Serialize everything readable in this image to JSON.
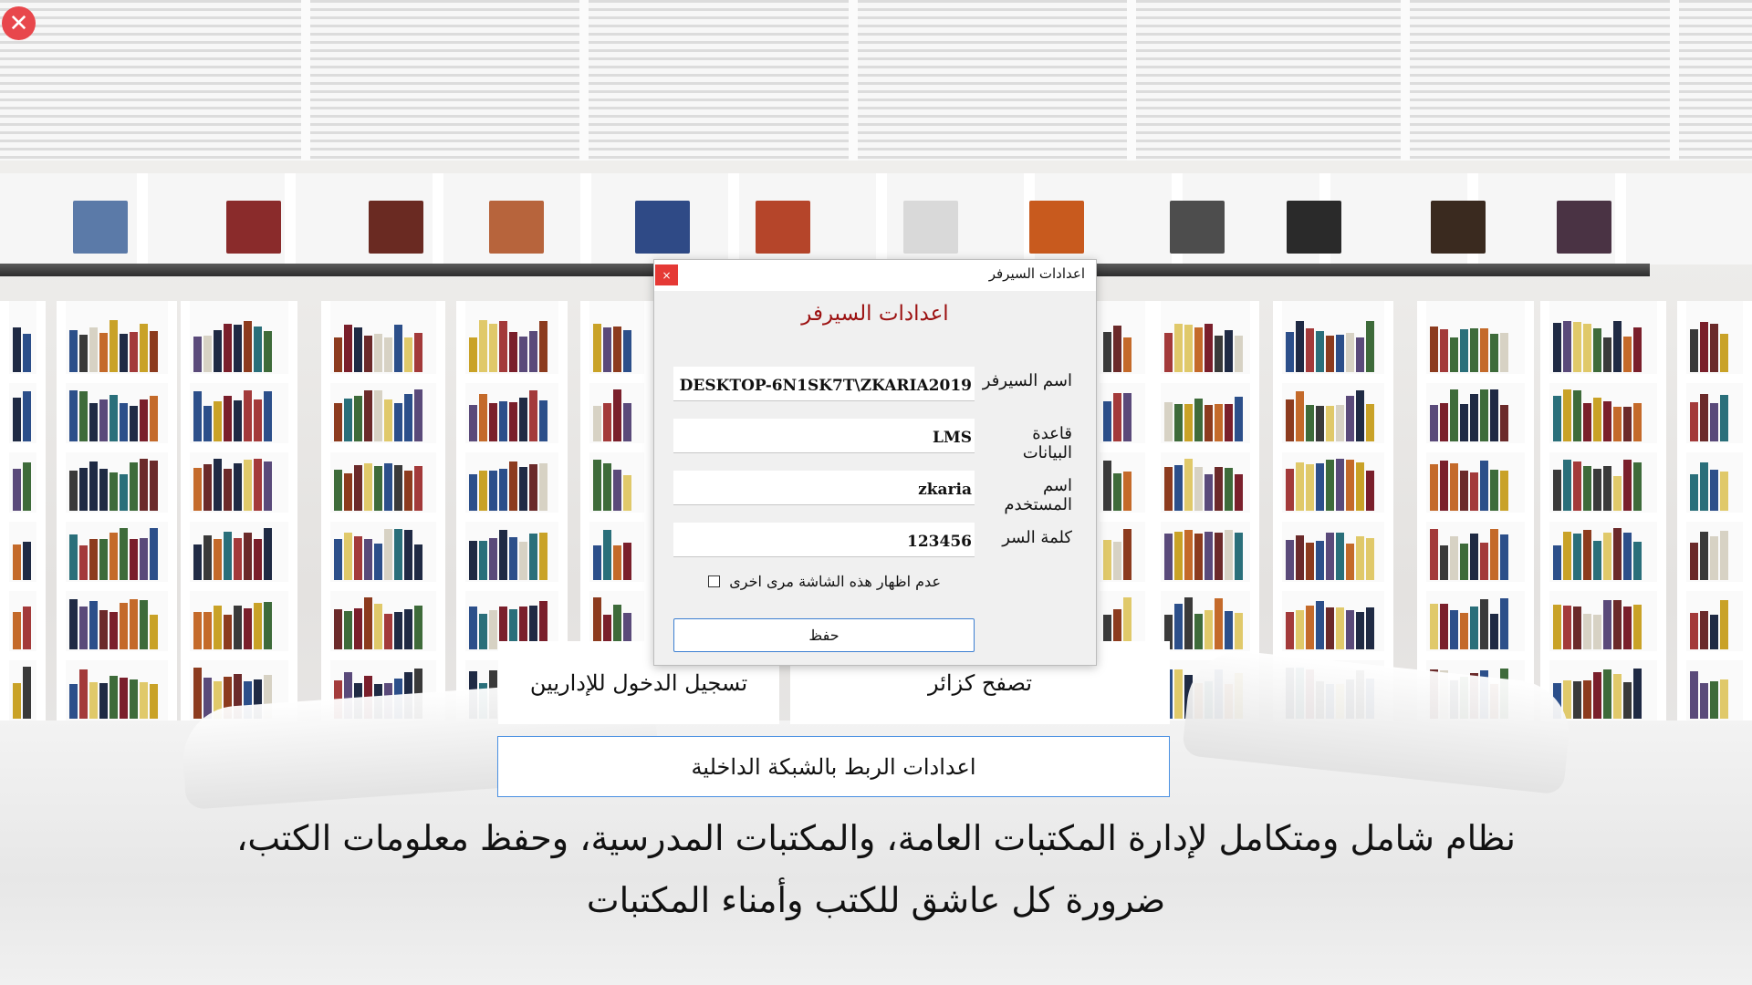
{
  "app": {
    "close_glyph": "✕",
    "buttons": {
      "browse": "تصفح كزائر",
      "admin_login": "تسجيل الدخول للإداريين",
      "network_settings": "اعدادات الربط بالشبكة الداخلية"
    },
    "tagline": "نظام شامل ومتكامل لإدارة المكتبات العامة، والمكتبات المدرسية، وحفظ معلومات الكتب، ضرورة كل عاشق للكتب وأمناء المكتبات"
  },
  "dialog": {
    "window_title": "اعدادات السيرفر",
    "close_glyph": "×",
    "heading": "اعدادات السيرفر",
    "fields": {
      "server": {
        "label": "اسم السيرفر",
        "value": "DESKTOP-6N1SK7T\\ZKARIA2019"
      },
      "database": {
        "label": "قاعدة البيانات",
        "value": "LMS"
      },
      "username": {
        "label": "اسم المستخدم",
        "value": "zkaria"
      },
      "password": {
        "label": "كلمة السر",
        "value": "123456"
      }
    },
    "checkbox": {
      "label": "عدم اظهار هذه الشاشة مرى اخرى",
      "checked": false
    },
    "save_label": "حفظ"
  },
  "colors": {
    "accent_red": "#9c1111",
    "close_red": "#e53935",
    "focus_blue": "#3c7fd1"
  }
}
